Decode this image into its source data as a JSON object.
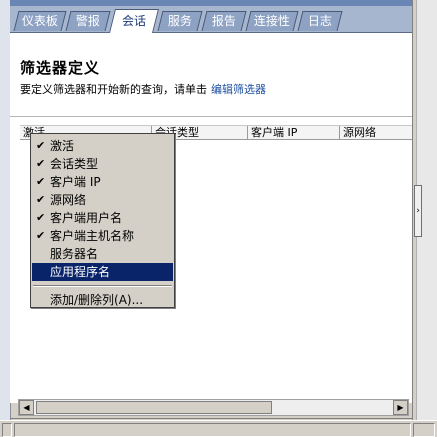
{
  "tabs": [
    {
      "label": "仪表板"
    },
    {
      "label": "警报"
    },
    {
      "label": "会话"
    },
    {
      "label": "服务"
    },
    {
      "label": "报告"
    },
    {
      "label": "连接性"
    },
    {
      "label": "日志"
    }
  ],
  "header": {
    "title": "筛选器定义",
    "description": "要定义筛选器和开始新的查询，请单击",
    "link": "编辑筛选器"
  },
  "grid": {
    "columns": [
      "激活",
      "会话类型",
      "客户端 IP",
      "源网络"
    ]
  },
  "context_menu": {
    "items": [
      {
        "label": "激活",
        "checked": true
      },
      {
        "label": "会话类型",
        "checked": true
      },
      {
        "label": "客户端 IP",
        "checked": true
      },
      {
        "label": "源网络",
        "checked": true
      },
      {
        "label": "客户端用户名",
        "checked": true
      },
      {
        "label": "客户端主机名称",
        "checked": true
      },
      {
        "label": "服务器名",
        "checked": false
      },
      {
        "label": "应用程序名",
        "checked": false,
        "selected": true
      }
    ],
    "add_remove_label": "添加/删除列(A)...",
    "check_glyph": "✔"
  },
  "scrollbar": {
    "left_arrow": "◀",
    "right_arrow": "▶"
  },
  "splitter": {
    "arrow": "›"
  },
  "colors": {
    "accent": "#0a246a",
    "tab_bg": "#8ea2c4",
    "link": "#1d4fa0"
  }
}
